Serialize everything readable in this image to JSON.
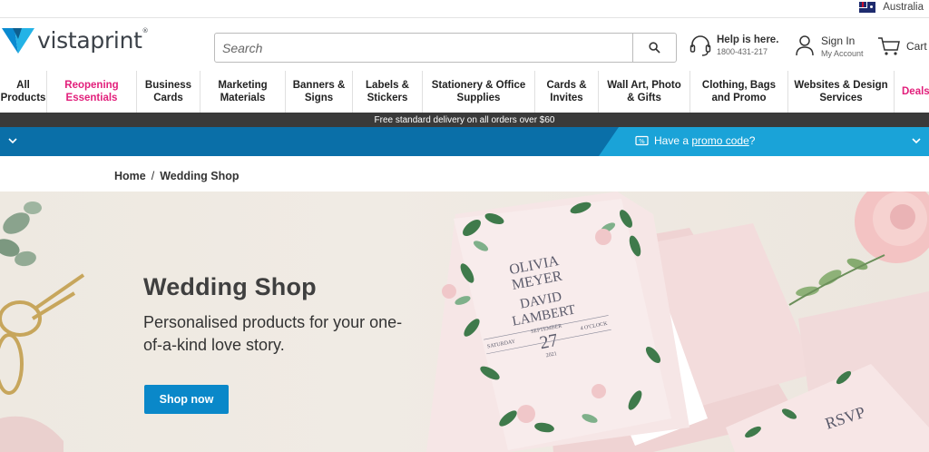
{
  "region": {
    "label": "Australia"
  },
  "brand": {
    "name": "vistaprint"
  },
  "search": {
    "placeholder": "Search"
  },
  "help": {
    "title": "Help is here.",
    "phone": "1800-431-217"
  },
  "account": {
    "title": "Sign In",
    "subtitle": "My Account"
  },
  "cart": {
    "label": "Cart"
  },
  "nav": {
    "items": [
      {
        "line1": "All",
        "line2": "Products"
      },
      {
        "line1": "Reopening",
        "line2": "Essentials"
      },
      {
        "line1": "Business",
        "line2": "Cards"
      },
      {
        "line1": "Marketing",
        "line2": "Materials"
      },
      {
        "line1": "Banners &",
        "line2": "Signs"
      },
      {
        "line1": "Labels &",
        "line2": "Stickers"
      },
      {
        "line1": "Stationery & Office",
        "line2": "Supplies"
      },
      {
        "line1": "Cards &",
        "line2": "Invites"
      },
      {
        "line1": "Wall Art, Photo",
        "line2": "& Gifts"
      },
      {
        "line1": "Clothing, Bags",
        "line2": "and Promo"
      },
      {
        "line1": "Websites & Design",
        "line2": "Services"
      },
      {
        "line1": "Deals",
        "line2": ""
      }
    ]
  },
  "delivery": {
    "text": "Free standard delivery on all orders over $60"
  },
  "promo": {
    "prefix": "Have a",
    "link": "promo code",
    "suffix": "?"
  },
  "breadcrumb": {
    "home": "Home",
    "separator": "/",
    "current": "Wedding Shop"
  },
  "hero": {
    "title": "Wedding Shop",
    "subtitle": "Personalised products for your one-of-a-kind love story.",
    "cta": "Shop now"
  },
  "invitation": {
    "name1a": "OLIVIA",
    "name1b": "MEYER",
    "name2a": "DAVID",
    "name2b": "LAMBERT",
    "day": "SATURDAY",
    "month": "SEPTEMBER",
    "date": "27",
    "year": "2021",
    "time": "4 O'CLOCK",
    "rsvp": "RSVP"
  },
  "colors": {
    "accent_pink": "#e21f7b",
    "promo_dark": "#0a6fa8",
    "promo_light": "#1aa3d8",
    "cta": "#0a88c9"
  }
}
